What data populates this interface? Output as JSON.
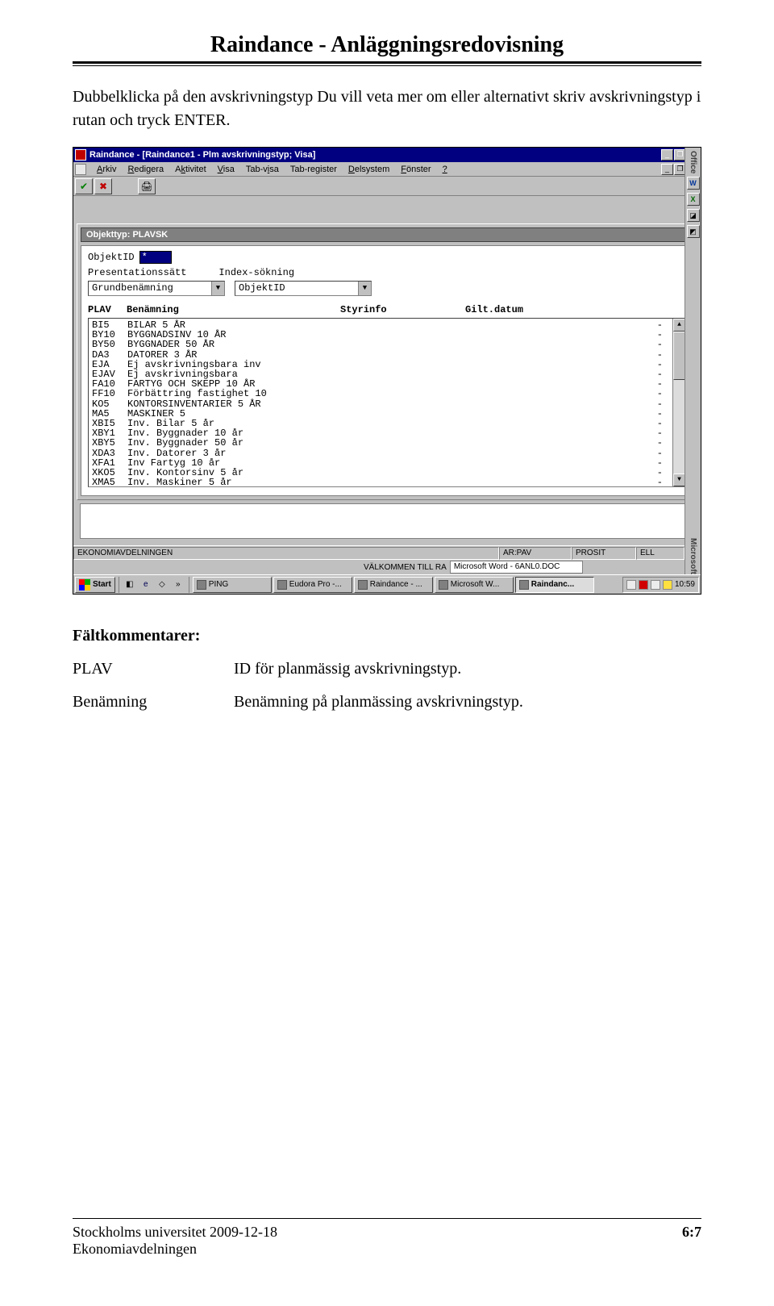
{
  "doc": {
    "title": "Raindance - Anläggningsredovisning",
    "intro": "Dubbelklicka på den avskrivningstyp Du vill veta mer om eller alternativt skriv avskrivningstyp i rutan och tryck ENTER.",
    "section_head": "Fältkommentarer:",
    "defs": [
      {
        "label": "PLAV",
        "text": "ID för planmässig avskrivningstyp."
      },
      {
        "label": "Benämning",
        "text": "Benämning på planmässing avskrivningstyp."
      }
    ]
  },
  "win": {
    "title": "Raindance - [Raindance1 - Plm avskrivningstyp; Visa]",
    "menu": [
      "Arkiv",
      "Redigera",
      "Aktivitet",
      "Visa",
      "Tab-visa",
      "Tab-register",
      "Delsystem",
      "Fönster",
      "?"
    ],
    "obj_title": "Objekttyp: PLAVSK",
    "objid_label": "ObjektID",
    "objid_value": "*",
    "pres_label": "Presentationssätt",
    "idx_label": "Index-sökning",
    "combo1": "Grundbenämning",
    "combo2": "ObjektID",
    "headers": {
      "plav": "PLAV",
      "ben": "Benämning",
      "styr": "Styrinfo",
      "gilt": "Gilt.datum"
    },
    "rows": [
      {
        "plav": "BI5",
        "ben": "BILAR 5 ÅR"
      },
      {
        "plav": "BY10",
        "ben": "BYGGNADSINV 10 ÅR"
      },
      {
        "plav": "BY50",
        "ben": "BYGGNADER 50 ÅR"
      },
      {
        "plav": "DA3",
        "ben": "DATORER 3 ÅR"
      },
      {
        "plav": "EJA",
        "ben": "Ej avskrivningsbara inv"
      },
      {
        "plav": "EJAV",
        "ben": "Ej avskrivningsbara"
      },
      {
        "plav": "FA10",
        "ben": "FARTYG OCH SKEPP 10 ÅR"
      },
      {
        "plav": "FF10",
        "ben": "Förbättring fastighet 10"
      },
      {
        "plav": "KO5",
        "ben": "KONTORSINVENTARIER 5 ÅR"
      },
      {
        "plav": "MA5",
        "ben": "MASKINER 5"
      },
      {
        "plav": "XBI5",
        "ben": "Inv. Bilar 5 år"
      },
      {
        "plav": "XBY1",
        "ben": "Inv. Byggnader 10 år"
      },
      {
        "plav": "XBY5",
        "ben": "Inv. Byggnader 50 år"
      },
      {
        "plav": "XDA3",
        "ben": "Inv. Datorer 3 år"
      },
      {
        "plav": "XFA1",
        "ben": "Inv Fartyg 10 år"
      },
      {
        "plav": "XKO5",
        "ben": "Inv. Kontorsinv 5 år"
      },
      {
        "plav": "XMA5",
        "ben": "Inv. Maskiner 5 år"
      }
    ],
    "status": {
      "left": "EKONOMIAVDELNINGEN",
      "ar": "AR:PAV",
      "prosit": "PROSIT",
      "ell": "ELL",
      "welcome": "VÄLKOMMEN TILL RA",
      "msword": "Microsoft Word - 6ANL0.DOC"
    }
  },
  "taskbar": {
    "start": "Start",
    "tasks": [
      {
        "label": "PING",
        "active": false
      },
      {
        "label": "Eudora Pro -...",
        "active": false
      },
      {
        "label": "Raindance - ...",
        "active": false
      },
      {
        "label": "Microsoft W...",
        "active": false
      },
      {
        "label": "Raindanc...",
        "active": true
      }
    ],
    "clock": "10:59"
  },
  "office": {
    "top": "Office",
    "bottom": "Microsoft"
  },
  "footer": {
    "left1": "Stockholms universitet 2009-12-18",
    "left2": "Ekonomiavdelningen",
    "right": "6:7"
  }
}
